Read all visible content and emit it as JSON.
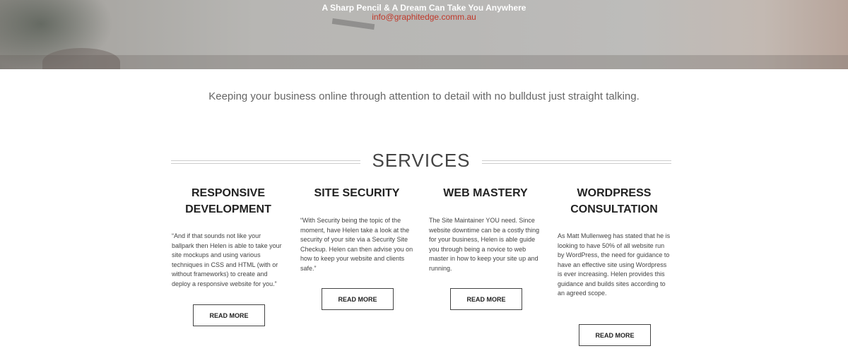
{
  "hero": {
    "tagline": "A Sharp Pencil & A Dream Can Take You Anywhere",
    "email": "info@graphitedge.comm.au"
  },
  "intro": "Keeping your business online through attention to detail with no bulldust just straight talking.",
  "services": {
    "title": "SERVICES",
    "items": [
      {
        "title_line1": "RESPONSIVE",
        "title_line2": "DEVELOPMENT",
        "text": "“And if that sounds not like your ballpark then Helen is able to take your site mockups and using various techniques in CSS and HTML (with or without frameworks) to create and deploy a responsive website for you.”",
        "button": "READ MORE"
      },
      {
        "title_line1": "SITE SECURITY",
        "title_line2": "",
        "text": "“With Security being the topic of the moment, have Helen take a look at the security of your site via a Security Site Checkup. Helen can then advise you on how to keep your website and clients safe.”",
        "button": "READ MORE"
      },
      {
        "title_line1": "WEB MASTERY",
        "title_line2": "",
        "text": "The Site Maintainer YOU need. Since website downtime can be a costly thing for your business, Helen is able guide you through being a novice to web master in how to keep your site up and running.",
        "button": "READ MORE"
      },
      {
        "title_line1": "WORDPRESS",
        "title_line2": "CONSULTATION",
        "text": "As Matt Mullenweg has stated that he is looking to have 50% of all website run by WordPress, the need for guidance to have an effective site using Wordpress is ever increasing. Helen provides this guidance and builds sites according to an agreed scope.",
        "button": "READ MORE"
      }
    ]
  }
}
